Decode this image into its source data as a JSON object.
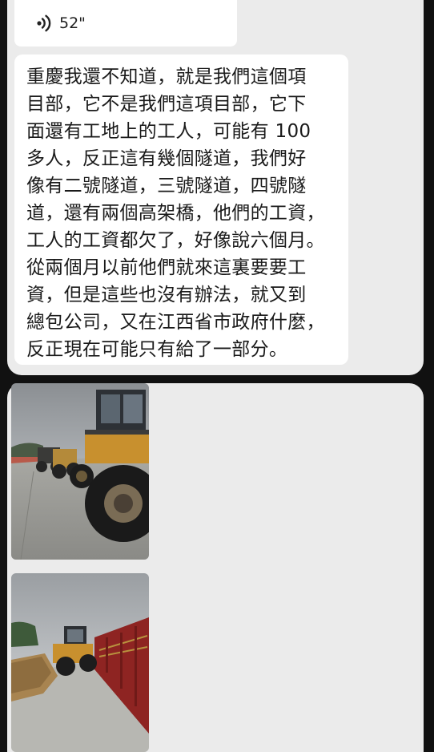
{
  "voice_message": {
    "icon": "voice-wave-icon",
    "duration": "52\""
  },
  "text_message": {
    "lines": [
      "重慶我還不知道，就是我們這個項",
      "目部，它不是我們這項目部，它下",
      "面還有工地上的工人，可能有 100",
      "多人，反正這有幾個隧道，我們好",
      "像有二號隧道，三號隧道，四號隧",
      "道，還有兩個高架橋，他們的工資，",
      "工人的工資都欠了，好像說六個月。",
      "從兩個月以前他們就來這裏要要工",
      "資，但是這些也沒有辦法，就又到",
      "總包公司，又在江西省市政府什麼，",
      "反正現在可能只有給了一部分。"
    ]
  },
  "photos": [
    {
      "subject": "wheel-loaders-parked-on-concrete"
    },
    {
      "subject": "wheel-loader-beside-red-sign-wall"
    }
  ],
  "colors": {
    "background": "#111111",
    "panel": "#ebebeb",
    "bubble": "#ffffff",
    "text": "#1a1a1a",
    "loader_yellow": "#c8902e"
  }
}
